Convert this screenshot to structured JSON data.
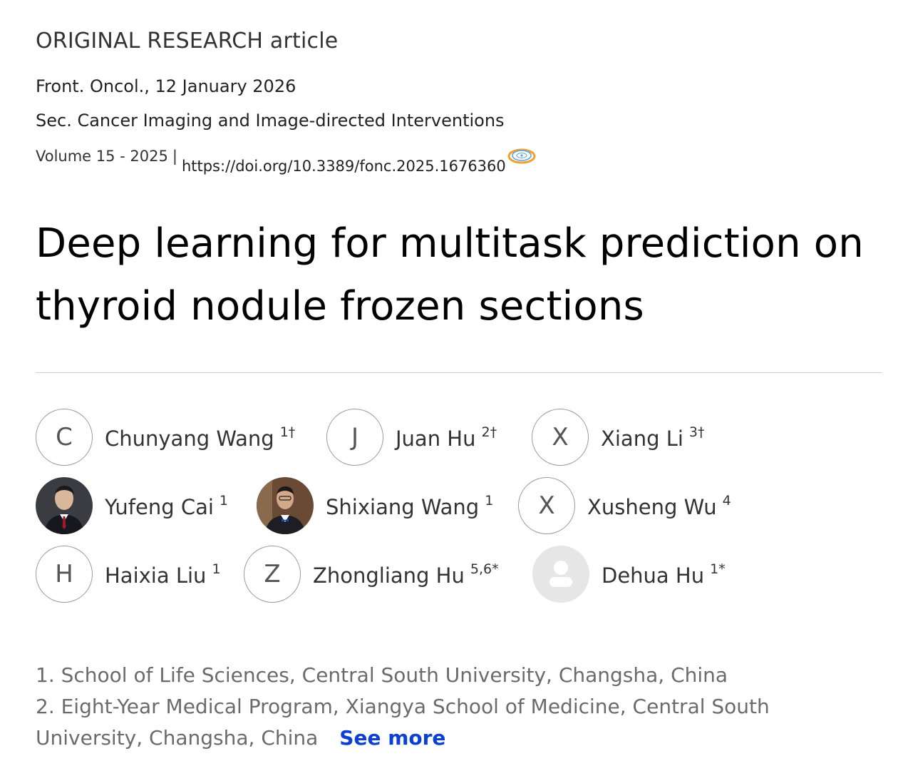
{
  "article": {
    "type": "ORIGINAL RESEARCH article",
    "journal": "Front. Oncol., 12 January 2026",
    "section": "Sec. Cancer Imaging and Image-directed Interventions",
    "volume": "Volume 15 - 2025",
    "separator": "|",
    "doi": "https://doi.org/10.3389/fonc.2025.1676360",
    "title": "Deep learning for multitask prediction on thyroid nodule frozen sections"
  },
  "authors": [
    {
      "initial": "C",
      "name": "Chunyang Wang",
      "sup": "1†",
      "avatar": "initial"
    },
    {
      "initial": "J",
      "name": "Juan Hu",
      "sup": "2†",
      "avatar": "initial"
    },
    {
      "initial": "X",
      "name": "Xiang Li",
      "sup": "3†",
      "avatar": "initial"
    },
    {
      "initial": "",
      "name": "Yufeng Cai",
      "sup": "1",
      "avatar": "photo"
    },
    {
      "initial": "",
      "name": "Shixiang Wang",
      "sup": "1",
      "avatar": "photo"
    },
    {
      "initial": "X",
      "name": "Xusheng Wu",
      "sup": "4",
      "avatar": "initial"
    },
    {
      "initial": "H",
      "name": "Haixia Liu",
      "sup": "1",
      "avatar": "initial"
    },
    {
      "initial": "Z",
      "name": "Zhongliang Hu",
      "sup": "5,6*",
      "avatar": "initial"
    },
    {
      "initial": "",
      "name": "Dehua Hu",
      "sup": "1*",
      "avatar": "placeholder"
    }
  ],
  "affiliations": {
    "line1": "1. School of Life Sciences, Central South University, Changsha, China",
    "line2": "2. Eight-Year Medical Program, Xiangya School of Medicine, Central South",
    "line3": "University, Changsha, China",
    "see_more": "See more"
  },
  "colors": {
    "link": "#0b3fd6",
    "muted_text": "#6b6b6b",
    "avatar_border": "#9a9a9a",
    "placeholder_bg": "#e6e6e6"
  },
  "icons": {
    "altmetric": "altmetric-badge-icon",
    "user_placeholder": "user-placeholder-icon"
  }
}
